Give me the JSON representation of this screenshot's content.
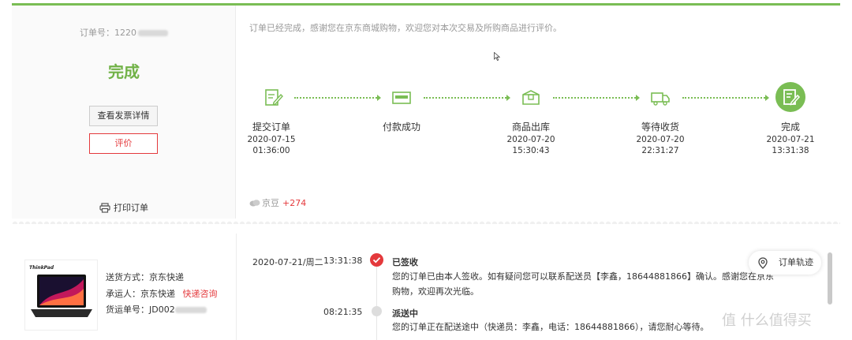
{
  "order": {
    "number_label": "订单号：",
    "number_visible": "1220",
    "status": "完成",
    "invoice_button": "查看发票详情",
    "review_button": "评价",
    "print_label": "打印订单"
  },
  "progress": {
    "thanks_text": "订单已经完成，感谢您在京东商城购物，欢迎您对本次交易及所购商品进行评价。",
    "steps": [
      {
        "label": "提交订单",
        "date": "2020-07-15",
        "time": "01:36:00",
        "icon": "edit-order-icon"
      },
      {
        "label": "付款成功",
        "date": "",
        "time": "",
        "icon": "payment-card-icon"
      },
      {
        "label": "商品出库",
        "date": "2020-07-20",
        "time": "15:30:43",
        "icon": "package-icon"
      },
      {
        "label": "等待收货",
        "date": "2020-07-20",
        "time": "22:31:27",
        "icon": "delivery-truck-icon"
      },
      {
        "label": "完成",
        "date": "2020-07-21",
        "time": "13:31:38",
        "icon": "completed-check-icon"
      }
    ],
    "jd_bean_label": "京豆",
    "jd_bean_value": "+274",
    "accent_color": "#7abd54"
  },
  "shipment": {
    "product_brand": "ThinkPad",
    "method_label": "送货方式：京东快递",
    "carrier_label": "承运人：京东快递",
    "carrier_link": "快递咨询",
    "tracking_label": "货运单号：JD002"
  },
  "timeline": [
    {
      "date": "2020-07-21/周二",
      "time": "13:31:38",
      "title": "已签收",
      "lines": [
        "您的订单已由本人签收。如有疑问您可以联系配送员【李鑫，18644881866】确认。感谢您在京东",
        "购物，欢迎再次光临。"
      ],
      "active": true
    },
    {
      "date": "",
      "time": "08:21:35",
      "title": "派送中",
      "lines": [
        "您的订单正在配送途中（快递员：李鑫，电话：18644881866），请您耐心等待。"
      ],
      "active": false
    }
  ],
  "track_button": "订单轨迹",
  "watermark": "值 什么值得买"
}
